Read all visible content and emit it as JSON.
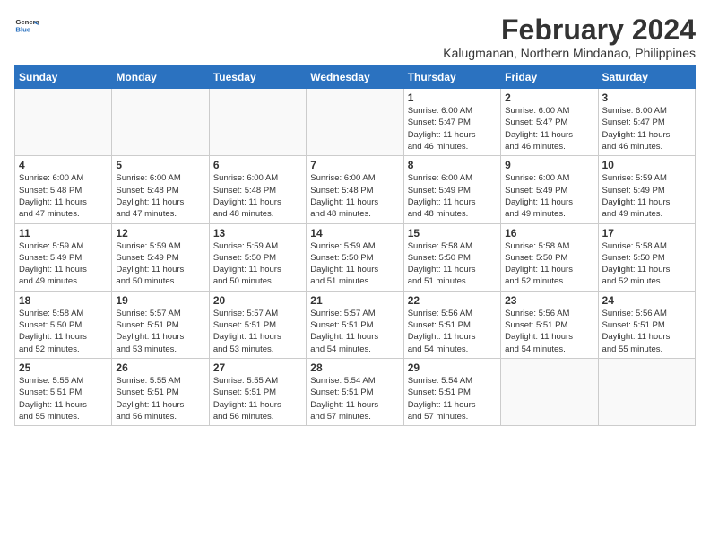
{
  "logo": {
    "line1": "General",
    "line2": "Blue"
  },
  "title": "February 2024",
  "location": "Kalugmanan, Northern Mindanao, Philippines",
  "days_header": [
    "Sunday",
    "Monday",
    "Tuesday",
    "Wednesday",
    "Thursday",
    "Friday",
    "Saturday"
  ],
  "weeks": [
    [
      {
        "day": "",
        "info": ""
      },
      {
        "day": "",
        "info": ""
      },
      {
        "day": "",
        "info": ""
      },
      {
        "day": "",
        "info": ""
      },
      {
        "day": "1",
        "info": "Sunrise: 6:00 AM\nSunset: 5:47 PM\nDaylight: 11 hours\nand 46 minutes."
      },
      {
        "day": "2",
        "info": "Sunrise: 6:00 AM\nSunset: 5:47 PM\nDaylight: 11 hours\nand 46 minutes."
      },
      {
        "day": "3",
        "info": "Sunrise: 6:00 AM\nSunset: 5:47 PM\nDaylight: 11 hours\nand 46 minutes."
      }
    ],
    [
      {
        "day": "4",
        "info": "Sunrise: 6:00 AM\nSunset: 5:48 PM\nDaylight: 11 hours\nand 47 minutes."
      },
      {
        "day": "5",
        "info": "Sunrise: 6:00 AM\nSunset: 5:48 PM\nDaylight: 11 hours\nand 47 minutes."
      },
      {
        "day": "6",
        "info": "Sunrise: 6:00 AM\nSunset: 5:48 PM\nDaylight: 11 hours\nand 48 minutes."
      },
      {
        "day": "7",
        "info": "Sunrise: 6:00 AM\nSunset: 5:48 PM\nDaylight: 11 hours\nand 48 minutes."
      },
      {
        "day": "8",
        "info": "Sunrise: 6:00 AM\nSunset: 5:49 PM\nDaylight: 11 hours\nand 48 minutes."
      },
      {
        "day": "9",
        "info": "Sunrise: 6:00 AM\nSunset: 5:49 PM\nDaylight: 11 hours\nand 49 minutes."
      },
      {
        "day": "10",
        "info": "Sunrise: 5:59 AM\nSunset: 5:49 PM\nDaylight: 11 hours\nand 49 minutes."
      }
    ],
    [
      {
        "day": "11",
        "info": "Sunrise: 5:59 AM\nSunset: 5:49 PM\nDaylight: 11 hours\nand 49 minutes."
      },
      {
        "day": "12",
        "info": "Sunrise: 5:59 AM\nSunset: 5:49 PM\nDaylight: 11 hours\nand 50 minutes."
      },
      {
        "day": "13",
        "info": "Sunrise: 5:59 AM\nSunset: 5:50 PM\nDaylight: 11 hours\nand 50 minutes."
      },
      {
        "day": "14",
        "info": "Sunrise: 5:59 AM\nSunset: 5:50 PM\nDaylight: 11 hours\nand 51 minutes."
      },
      {
        "day": "15",
        "info": "Sunrise: 5:58 AM\nSunset: 5:50 PM\nDaylight: 11 hours\nand 51 minutes."
      },
      {
        "day": "16",
        "info": "Sunrise: 5:58 AM\nSunset: 5:50 PM\nDaylight: 11 hours\nand 52 minutes."
      },
      {
        "day": "17",
        "info": "Sunrise: 5:58 AM\nSunset: 5:50 PM\nDaylight: 11 hours\nand 52 minutes."
      }
    ],
    [
      {
        "day": "18",
        "info": "Sunrise: 5:58 AM\nSunset: 5:50 PM\nDaylight: 11 hours\nand 52 minutes."
      },
      {
        "day": "19",
        "info": "Sunrise: 5:57 AM\nSunset: 5:51 PM\nDaylight: 11 hours\nand 53 minutes."
      },
      {
        "day": "20",
        "info": "Sunrise: 5:57 AM\nSunset: 5:51 PM\nDaylight: 11 hours\nand 53 minutes."
      },
      {
        "day": "21",
        "info": "Sunrise: 5:57 AM\nSunset: 5:51 PM\nDaylight: 11 hours\nand 54 minutes."
      },
      {
        "day": "22",
        "info": "Sunrise: 5:56 AM\nSunset: 5:51 PM\nDaylight: 11 hours\nand 54 minutes."
      },
      {
        "day": "23",
        "info": "Sunrise: 5:56 AM\nSunset: 5:51 PM\nDaylight: 11 hours\nand 54 minutes."
      },
      {
        "day": "24",
        "info": "Sunrise: 5:56 AM\nSunset: 5:51 PM\nDaylight: 11 hours\nand 55 minutes."
      }
    ],
    [
      {
        "day": "25",
        "info": "Sunrise: 5:55 AM\nSunset: 5:51 PM\nDaylight: 11 hours\nand 55 minutes."
      },
      {
        "day": "26",
        "info": "Sunrise: 5:55 AM\nSunset: 5:51 PM\nDaylight: 11 hours\nand 56 minutes."
      },
      {
        "day": "27",
        "info": "Sunrise: 5:55 AM\nSunset: 5:51 PM\nDaylight: 11 hours\nand 56 minutes."
      },
      {
        "day": "28",
        "info": "Sunrise: 5:54 AM\nSunset: 5:51 PM\nDaylight: 11 hours\nand 57 minutes."
      },
      {
        "day": "29",
        "info": "Sunrise: 5:54 AM\nSunset: 5:51 PM\nDaylight: 11 hours\nand 57 minutes."
      },
      {
        "day": "",
        "info": ""
      },
      {
        "day": "",
        "info": ""
      }
    ]
  ]
}
